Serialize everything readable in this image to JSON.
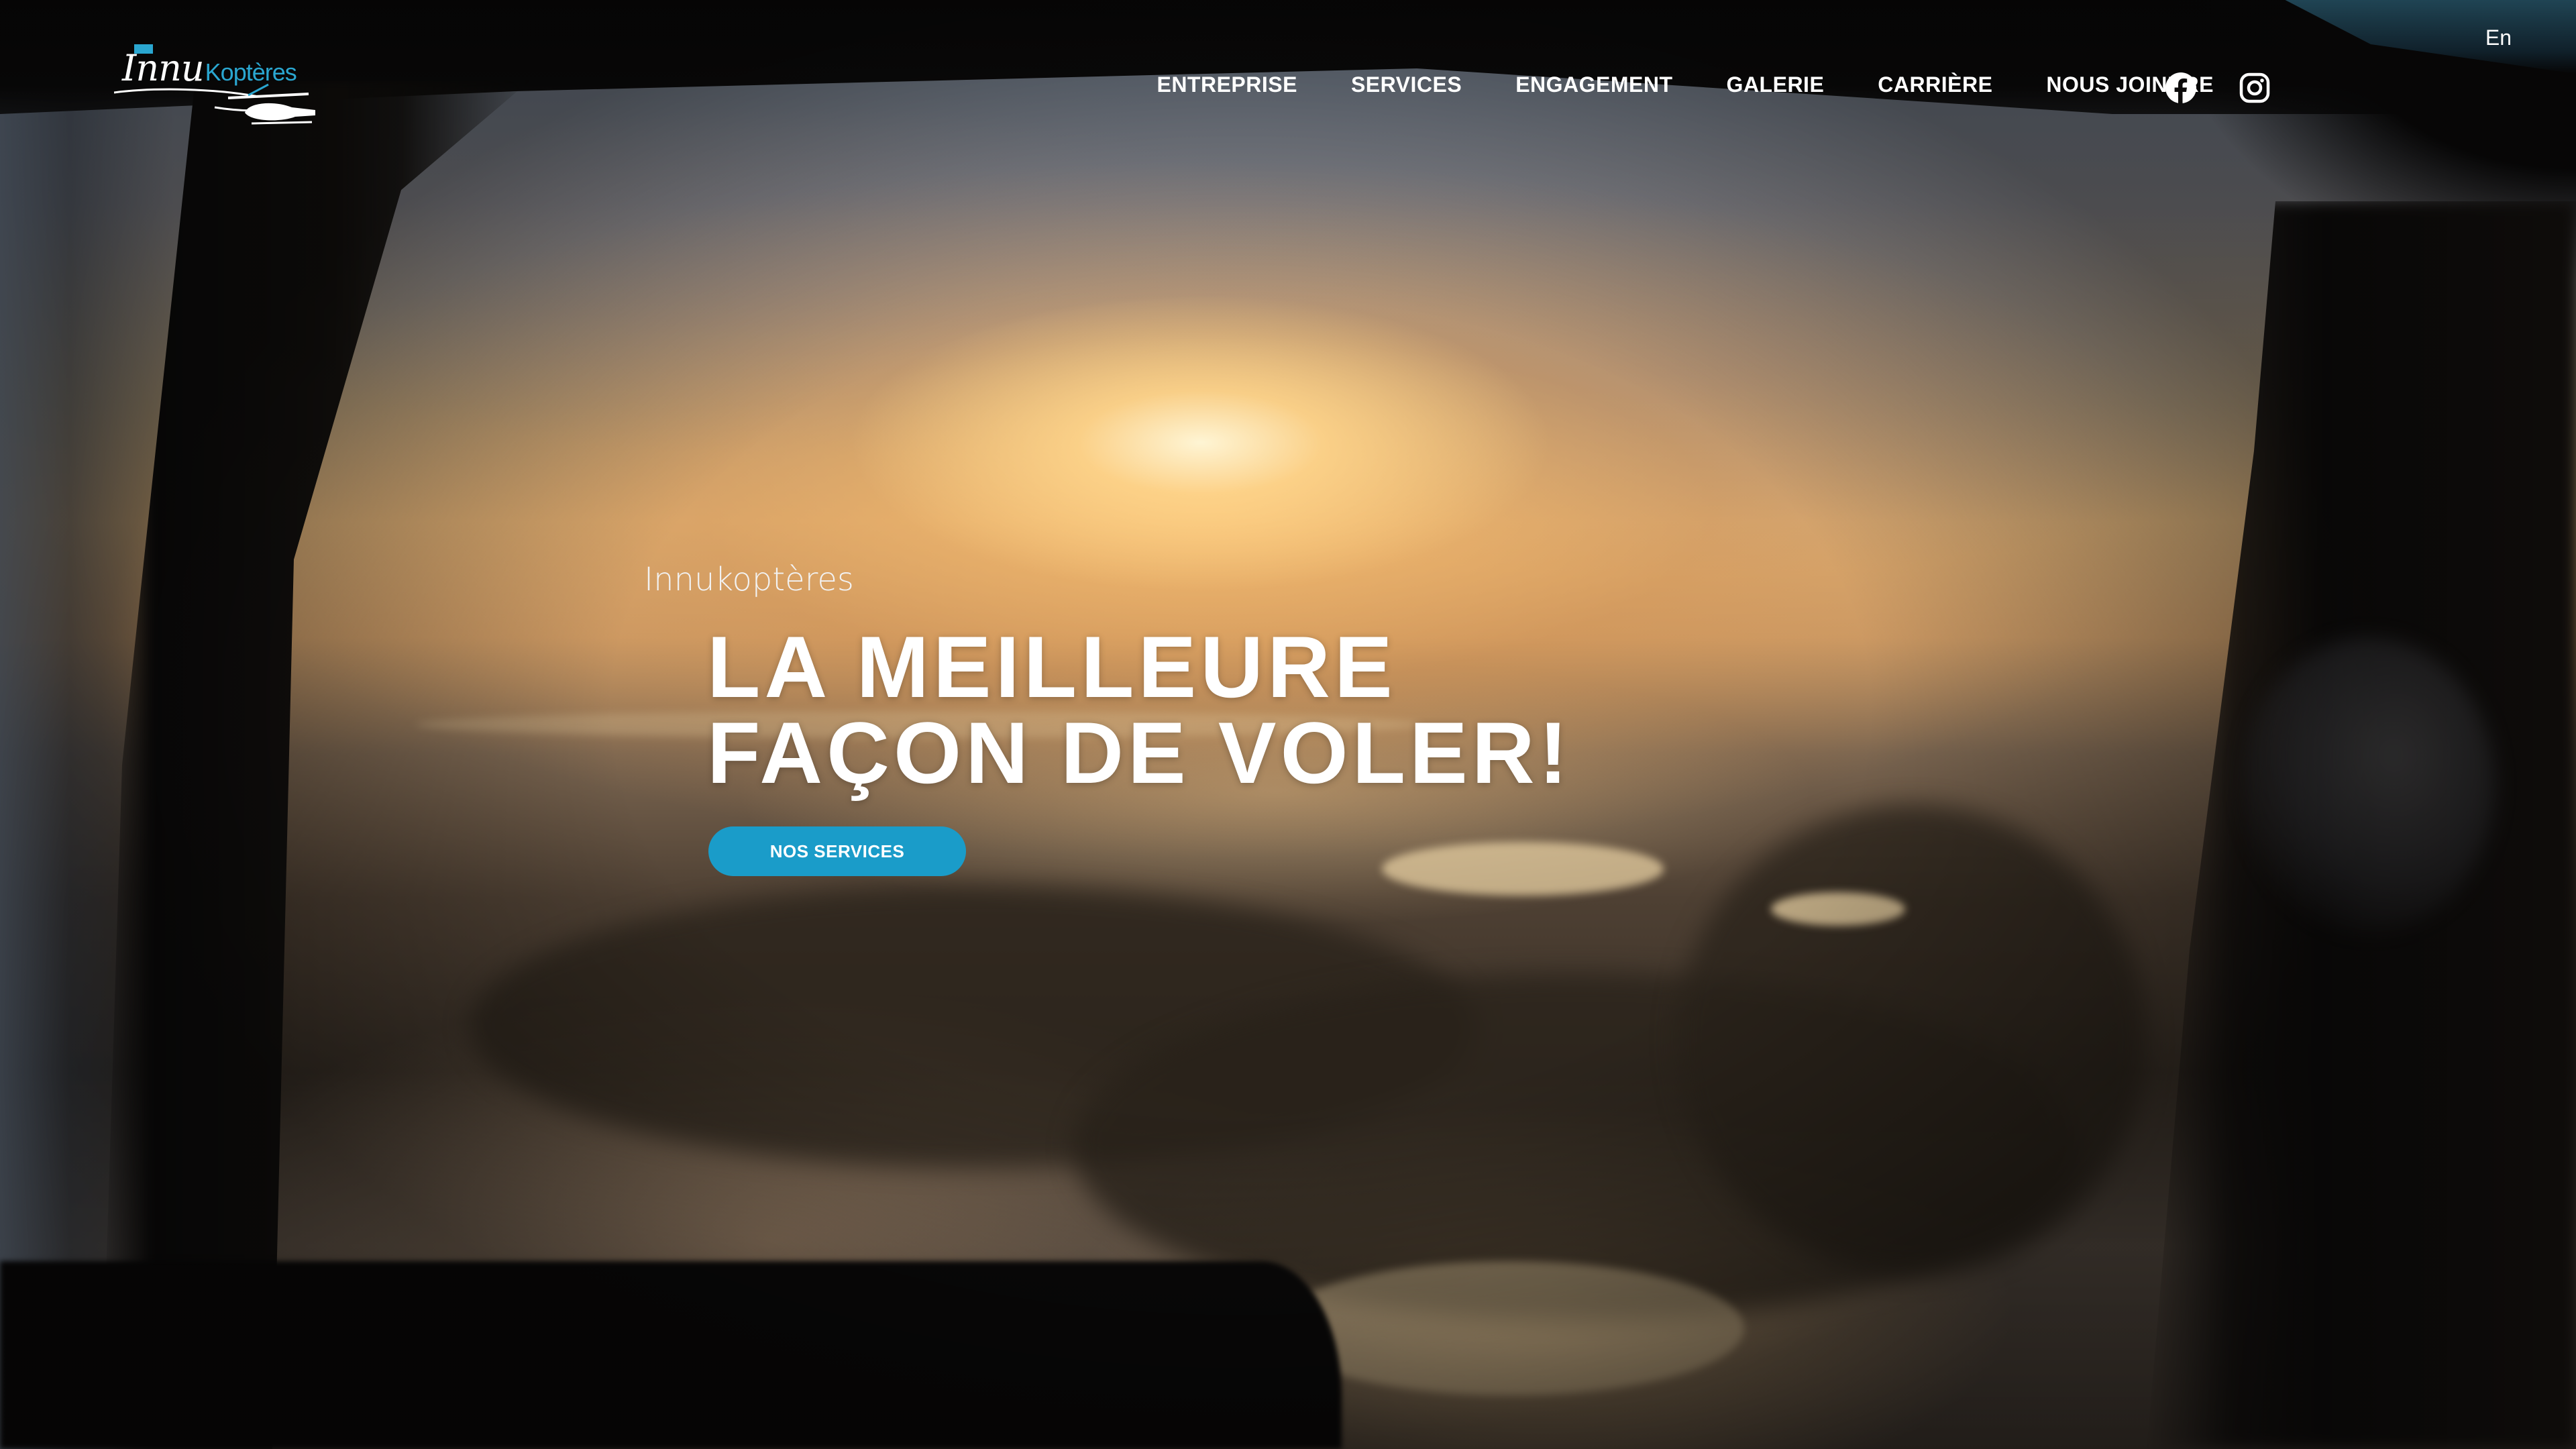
{
  "header": {
    "logo_text_main": "Innu",
    "logo_text_accent": "Koptères",
    "nav_items": [
      {
        "label": "ENTREPRISE"
      },
      {
        "label": "SERVICES"
      },
      {
        "label": "ENGAGEMENT"
      },
      {
        "label": "GALERIE"
      },
      {
        "label": "CARRIÈRE"
      },
      {
        "label": "NOUS JOINDRE"
      }
    ],
    "social_icons": [
      "facebook-icon",
      "instagram-icon"
    ],
    "language_toggle": "En"
  },
  "hero": {
    "eyebrow": "Innukoptères",
    "headline_line1": "LA MEILLEURE",
    "headline_line2": "FAÇON DE VOLER!",
    "cta_label": "NOS SERVICES",
    "cta_color": "#1a9cc9"
  },
  "theme": {
    "accent": "#1a9cc9",
    "text": "#ffffff"
  }
}
